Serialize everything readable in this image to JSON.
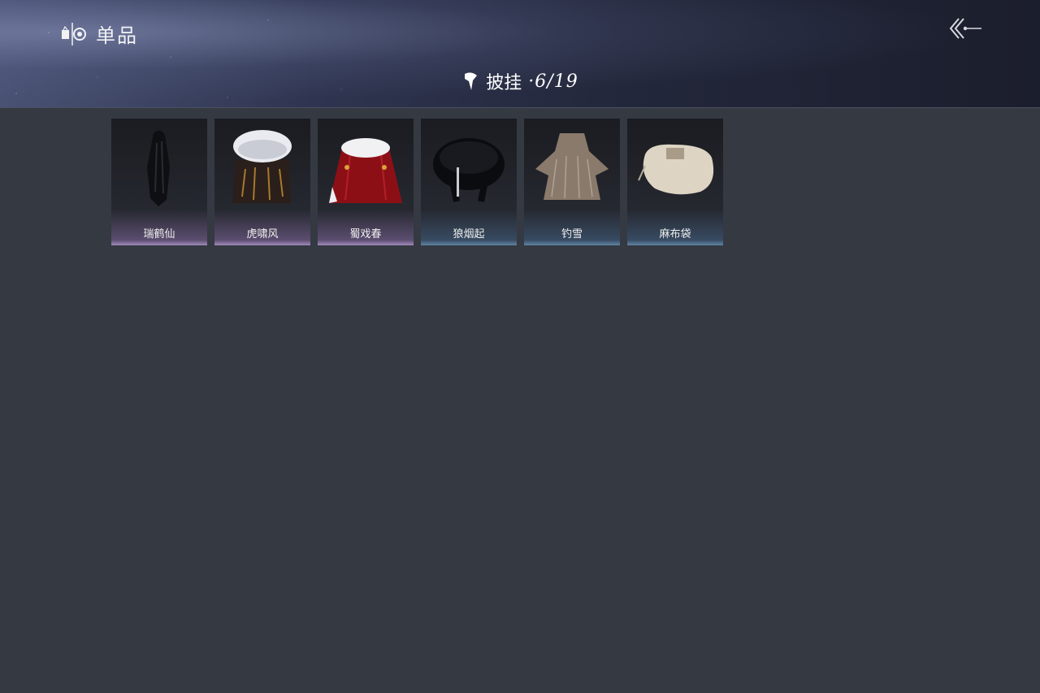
{
  "header": {
    "section_title": "单品",
    "category_title": "披挂",
    "category_count": "·6/19"
  },
  "items": [
    {
      "name": "瑞鹤仙",
      "icon": "dark-feather-cloak-icon"
    },
    {
      "name": "虎啸风",
      "icon": "fur-collar-tiger-cloak-icon"
    },
    {
      "name": "蜀戏春",
      "icon": "red-opera-cape-icon"
    },
    {
      "name": "狼烟起",
      "icon": "black-wolf-fur-cloak-icon"
    },
    {
      "name": "钓雪",
      "icon": "straw-raincoat-icon"
    },
    {
      "name": "麻布袋",
      "icon": "burlap-sack-icon"
    }
  ],
  "colors": {
    "background": "#353942",
    "rarity_purple": "#c8aae6",
    "rarity_blue": "#78aad2"
  }
}
